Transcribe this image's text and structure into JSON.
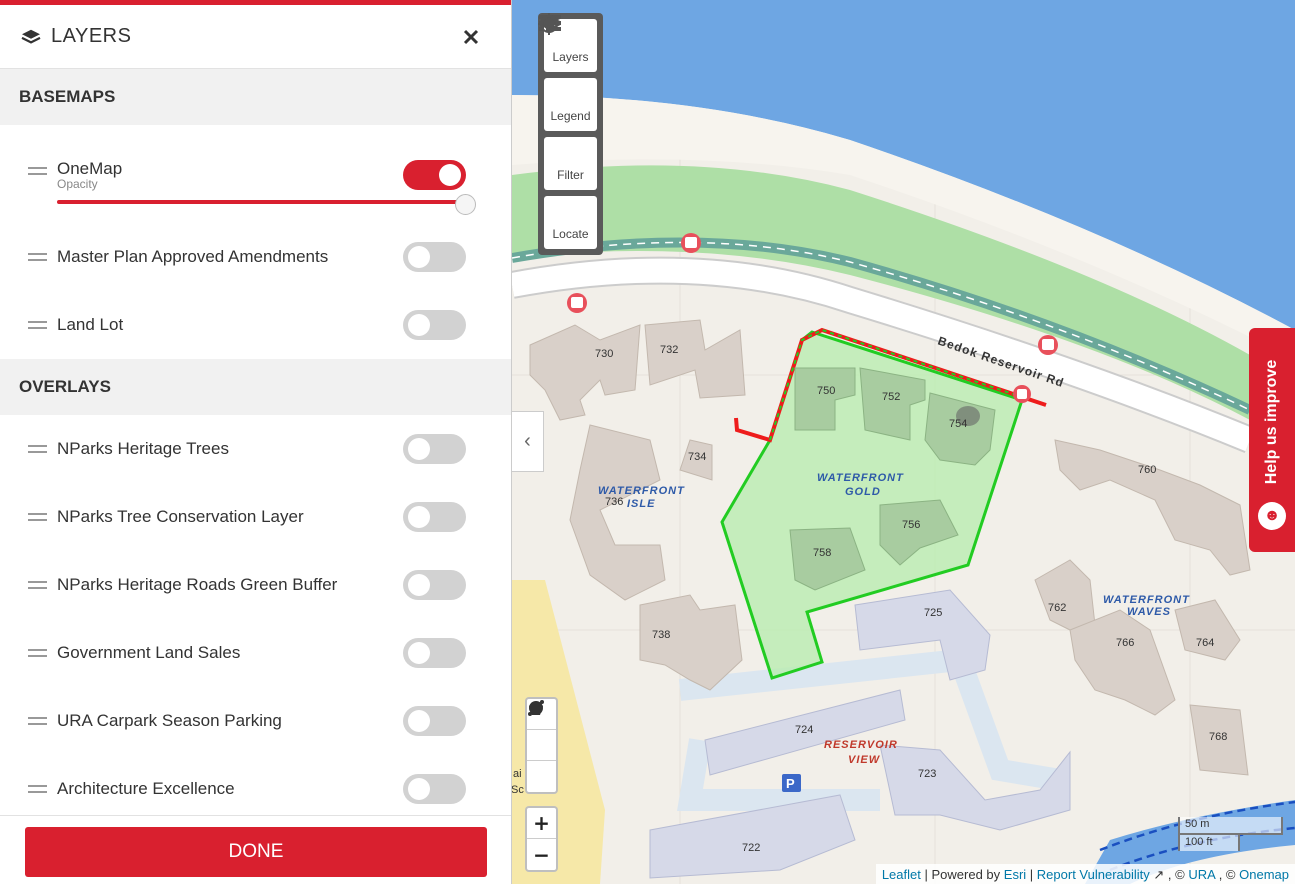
{
  "panel": {
    "title": "LAYERS",
    "close_icon": "close-icon",
    "basemaps_heading": "BASEMAPS",
    "overlays_heading": "OVERLAYS",
    "onemap": {
      "label": "OneMap",
      "opacity_label": "Opacity",
      "opacity": 1.0,
      "enabled": true
    },
    "basemaps": [
      {
        "label": "Master Plan Approved Amendments",
        "enabled": false
      },
      {
        "label": "Land Lot",
        "enabled": false
      }
    ],
    "overlays": [
      {
        "label": "NParks Heritage Trees",
        "enabled": false
      },
      {
        "label": "NParks Tree Conservation Layer",
        "enabled": false
      },
      {
        "label": "NParks Heritage Roads Green Buffer",
        "enabled": false
      },
      {
        "label": "Government Land Sales",
        "enabled": false
      },
      {
        "label": "URA Carpark Season Parking",
        "enabled": false
      },
      {
        "label": "Architecture Excellence",
        "enabled": false
      }
    ],
    "done_label": "DONE"
  },
  "map_toolbar": [
    {
      "label": "Layers",
      "icon": "layers-icon"
    },
    {
      "label": "Legend",
      "icon": "legend-icon"
    },
    {
      "label": "Filter",
      "icon": "filter-icon"
    },
    {
      "label": "Locate",
      "icon": "locate-icon"
    }
  ],
  "help_tab": {
    "label": "Help us improve",
    "icon": "smiley-icon"
  },
  "map": {
    "road_name": "Bedok Reservoir Rd",
    "estates": [
      {
        "name": [
          "WATERFRONT",
          "ISLE"
        ],
        "color": "#2e5aa8"
      },
      {
        "name": [
          "WATERFRONT",
          "GOLD"
        ],
        "color": "#2e5aa8"
      },
      {
        "name": [
          "WATERFRONT",
          "WAVES"
        ],
        "color": "#2e5aa8"
      },
      {
        "name": [
          "RESERVOIR",
          "VIEW"
        ],
        "color": "#c0392b"
      }
    ],
    "buildings": [
      "730",
      "732",
      "734",
      "736",
      "738",
      "750",
      "752",
      "754",
      "756",
      "758",
      "760",
      "762",
      "764",
      "766",
      "768",
      "722",
      "723",
      "724",
      "725"
    ],
    "partial_text": [
      "ai",
      "Sc"
    ]
  },
  "scale": {
    "metric": "50 m",
    "imperial": "100 ft"
  },
  "attribution": {
    "leaflet": "Leaflet",
    "powered": "Powered by",
    "esri": "Esri",
    "report": "Report Vulnerability",
    "ura": "URA",
    "onemap": "Onemap"
  },
  "colors": {
    "accent": "#d9202f",
    "water": "#6ea6e3",
    "park": "#a8dba0",
    "highlight_fill": "#b9ecb0",
    "highlight_stroke": "#22cc22"
  }
}
